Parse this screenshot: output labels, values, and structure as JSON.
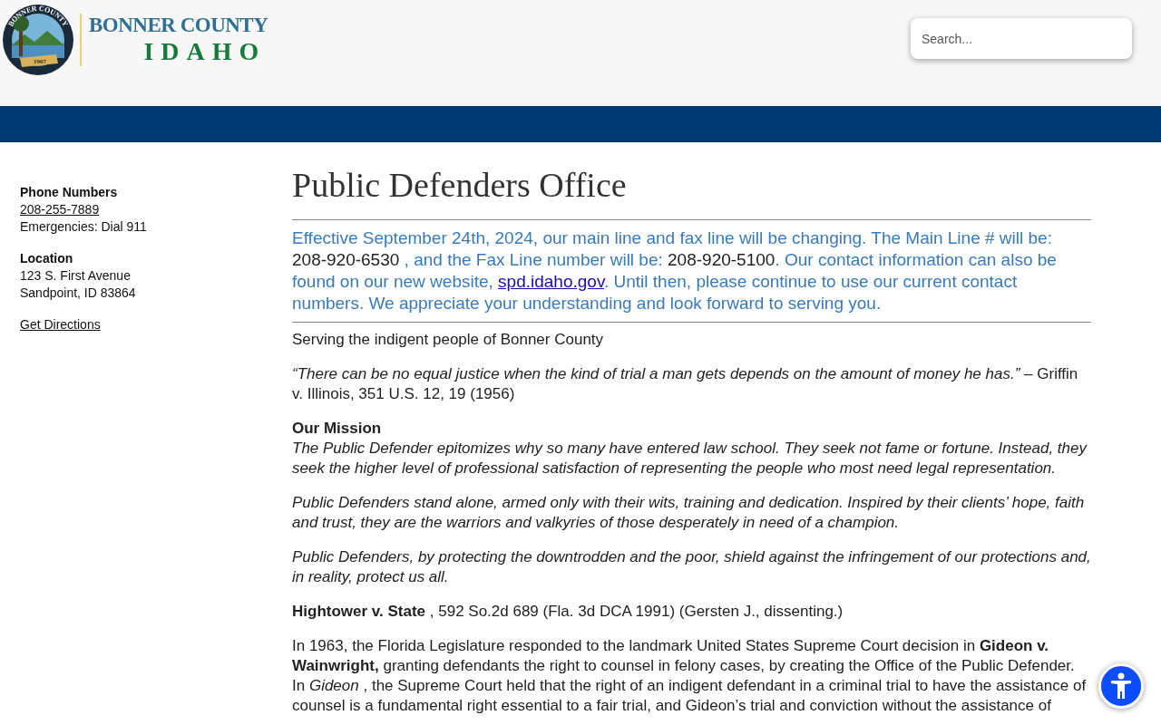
{
  "header": {
    "logo": {
      "seal_top": "BONNER COUNTY",
      "seal_year": "1907",
      "title": "BONNER COUNTY",
      "subtitle": "IDAHO"
    },
    "search": {
      "placeholder": "Search..."
    }
  },
  "sidebar": {
    "sections": [
      {
        "heading": "Phone Numbers",
        "lines": [
          {
            "kind": "link",
            "text": "208-255-7889"
          },
          {
            "kind": "text",
            "text": "Emergencies: Dial 911"
          }
        ]
      },
      {
        "heading": "Location",
        "lines": [
          {
            "kind": "text",
            "text": "123 S. First Avenue"
          },
          {
            "kind": "text",
            "text": "Sandpoint, ID 83864"
          }
        ]
      }
    ],
    "directions_link": "Get Directions"
  },
  "page_title": "Public Defenders Office",
  "notice": [
    {
      "kind": "text",
      "text": "Effective September 24th, 2024, our main line and fax line will be changing. The Main Line # will be: "
    },
    {
      "kind": "number",
      "text": "208-920-6530"
    },
    {
      "kind": "text",
      "text": " , and the Fax Line number will be: "
    },
    {
      "kind": "number",
      "text": "208-920-5100"
    },
    {
      "kind": "text",
      "text": ".  Our contact information can also be found on our new website, "
    },
    {
      "kind": "link",
      "text": "spd.idaho.gov"
    },
    {
      "kind": "text",
      "text": ".  Until then, please continue to use our current contact numbers. We appreciate your understanding and look forward to serving you."
    }
  ],
  "paragraphs": [
    {
      "kind": "plain",
      "text": "Serving the indigent people of Bonner County"
    },
    {
      "kind": "plain",
      "text": "*“There can be no equal justice when the kind of trial a man gets depends on the amount of money he has.”* – Griffin v. Illinois, 351 U.S. 12, 19 (1956)"
    },
    {
      "kind": "heading",
      "text": "Our Mission"
    },
    {
      "kind": "italic",
      "text": "The Public Defender epitomizes why so many have entered law school. They seek not fame or fortune. Instead, they seek the higher level of professional satisfaction of representing the people who most need legal representation."
    },
    {
      "kind": "italic",
      "text": "Public Defenders stand alone, armed only with their wits, training and dedication. Inspired by their clients’ hope, faith and trust, they are the warriors and valkyries of those desperately in need of a champion."
    },
    {
      "kind": "italic",
      "text": "Public Defenders, by protecting the downtrodden and the poor, shield against the infringement of our protections and, in reality, protect us all."
    },
    {
      "kind": "plain",
      "text": "**Hightower v. State** , 592 So.2d 689 (Fla. 3d DCA 1991) (Gersten J., dissenting.)"
    },
    {
      "kind": "plain",
      "text": "In 1963, the Florida Legislature responded to the landmark United States Supreme Court decision in **Gideon v. Wainwright,** granting defendants the right to counsel in felony cases, by creating the Office of the Public Defender. In *Gideon* , the Supreme Court held that the right of an indigent defendant in a criminal trial to have the assistance of counsel is a fundamental right essential to a fair trial, and Gideon’s trial and conviction without the assistance of"
    }
  ]
}
